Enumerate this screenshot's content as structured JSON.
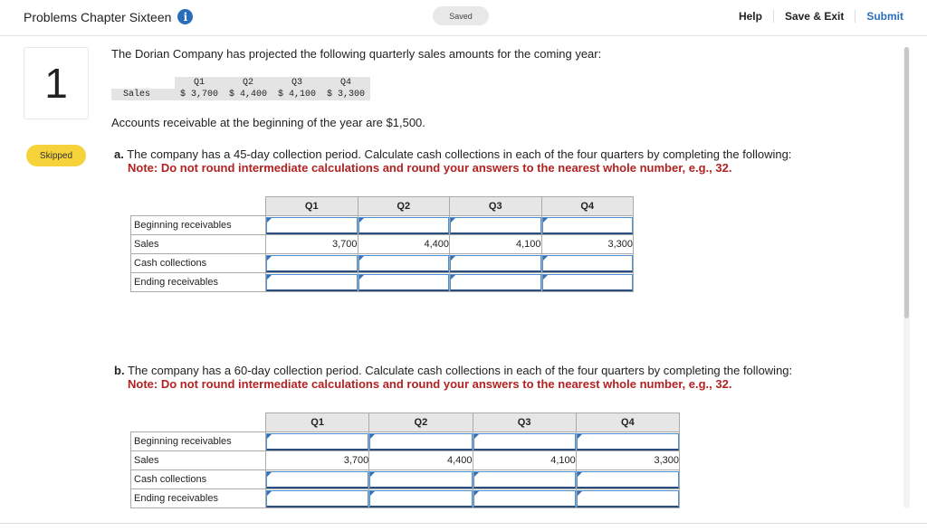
{
  "header": {
    "title": "Problems Chapter Sixteen",
    "info_icon": "info-icon",
    "saved_badge": "Saved",
    "help_label": "Help",
    "save_exit_label": "Save & Exit",
    "submit_label": "Submit"
  },
  "question": {
    "number": "1",
    "status": "Skipped",
    "intro": "The Dorian Company has projected the following quarterly sales amounts for the coming year:",
    "sales_table": {
      "row_label": "Sales",
      "quarters": [
        "Q1",
        "Q2",
        "Q3",
        "Q4"
      ],
      "values": [
        "$ 3,700",
        "$ 4,400",
        "$ 4,100",
        "$ 3,300"
      ]
    },
    "ar_text": "Accounts receivable at the beginning of the year are $1,500."
  },
  "part_a": {
    "letter": "a.",
    "prompt": "The company has a 45-day collection period. Calculate cash collections in each of the four quarters by completing the following:",
    "note": "Note: Do not round intermediate calculations and round your answers to the nearest whole number, e.g., 32.",
    "columns": [
      "Q1",
      "Q2",
      "Q3",
      "Q4"
    ],
    "rows": [
      {
        "label": "Beginning receivables",
        "type": "input",
        "values": [
          "",
          "",
          "",
          ""
        ]
      },
      {
        "label": "Sales",
        "type": "value",
        "values": [
          "3,700",
          "4,400",
          "4,100",
          "3,300"
        ]
      },
      {
        "label": "Cash collections",
        "type": "input",
        "values": [
          "",
          "",
          "",
          ""
        ]
      },
      {
        "label": "Ending receivables",
        "type": "input",
        "values": [
          "",
          "",
          "",
          ""
        ]
      }
    ]
  },
  "part_b": {
    "letter": "b.",
    "prompt": "The company has a 60-day collection period. Calculate cash collections in each of the four quarters by completing the following:",
    "note": "Note: Do not round intermediate calculations and round your answers to the nearest whole number, e.g., 32.",
    "columns": [
      "Q1",
      "Q2",
      "Q3",
      "Q4"
    ],
    "rows": [
      {
        "label": "Beginning receivables",
        "type": "input",
        "values": [
          "",
          "",
          "",
          ""
        ]
      },
      {
        "label": "Sales",
        "type": "value",
        "values": [
          "3,700",
          "4,400",
          "4,100",
          "3,300"
        ]
      },
      {
        "label": "Cash collections",
        "type": "input",
        "values": [
          "",
          "",
          "",
          ""
        ]
      },
      {
        "label": "Ending receivables",
        "type": "input",
        "values": [
          "",
          "",
          "",
          ""
        ]
      }
    ]
  }
}
